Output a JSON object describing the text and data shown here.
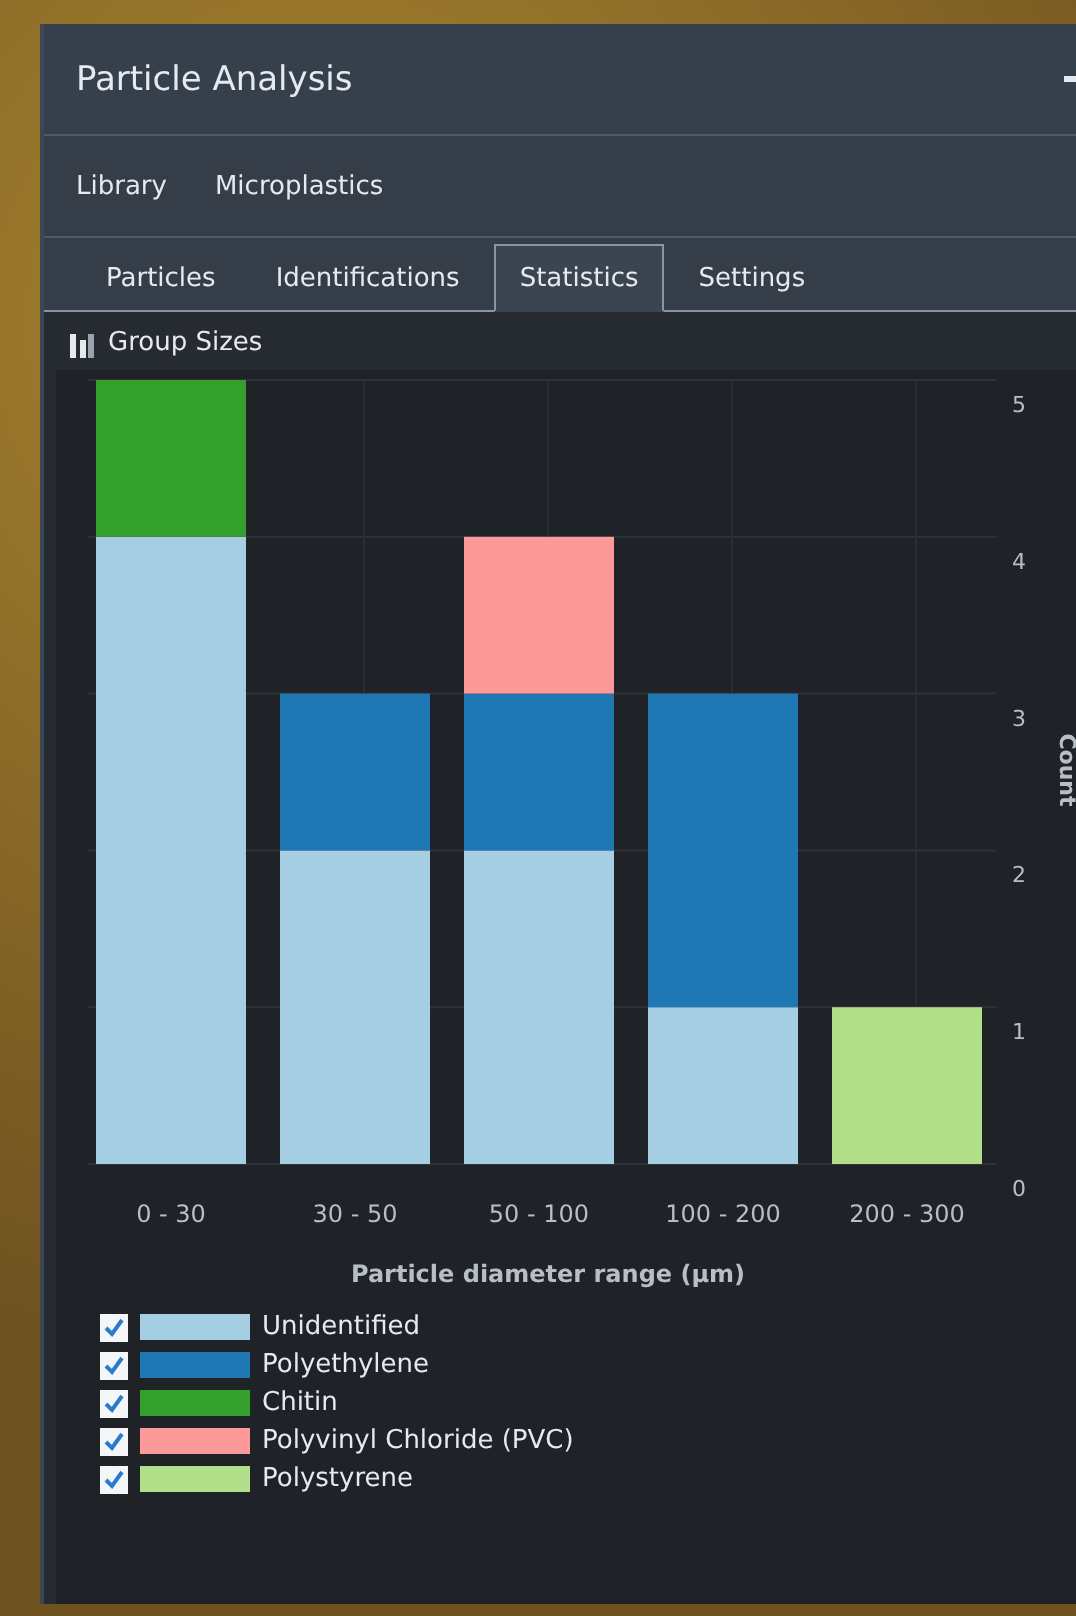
{
  "window": {
    "title": "Particle Analysis"
  },
  "breadcrumb": [
    "Library",
    "Microplastics"
  ],
  "tabs": [
    {
      "label": "Particles",
      "selected": false
    },
    {
      "label": "Identifications",
      "selected": false
    },
    {
      "label": "Statistics",
      "selected": true
    },
    {
      "label": "Settings",
      "selected": false
    }
  ],
  "section": {
    "title": "Group Sizes"
  },
  "chart_data": {
    "type": "bar",
    "stacked": true,
    "grid": true,
    "xlabel": "Particle diameter range (µm)",
    "ylabel": "Count",
    "categories": [
      "0 - 30",
      "30 - 50",
      "50 - 100",
      "100 - 200",
      "200 - 300"
    ],
    "series": [
      {
        "name": "Unidentified",
        "color": "#a6cee3",
        "values": [
          4,
          2,
          2,
          1,
          0
        ]
      },
      {
        "name": "Polyethylene",
        "color": "#1f78b4",
        "values": [
          0,
          1,
          1,
          2,
          0
        ]
      },
      {
        "name": "Chitin",
        "color": "#33a02c",
        "values": [
          1,
          0,
          0,
          0,
          0
        ]
      },
      {
        "name": "Polyvinyl Chloride (PVC)",
        "color": "#fb9a99",
        "values": [
          0,
          0,
          1,
          0,
          0
        ]
      },
      {
        "name": "Polystyrene",
        "color": "#b2df8a",
        "values": [
          0,
          0,
          0,
          0,
          1
        ]
      }
    ],
    "ylim": [
      0,
      5
    ],
    "yticks": [
      0,
      1,
      2,
      3,
      4,
      5
    ]
  },
  "legend_toggles": [
    {
      "checked": true
    },
    {
      "checked": true
    },
    {
      "checked": true
    },
    {
      "checked": true
    },
    {
      "checked": true
    }
  ]
}
